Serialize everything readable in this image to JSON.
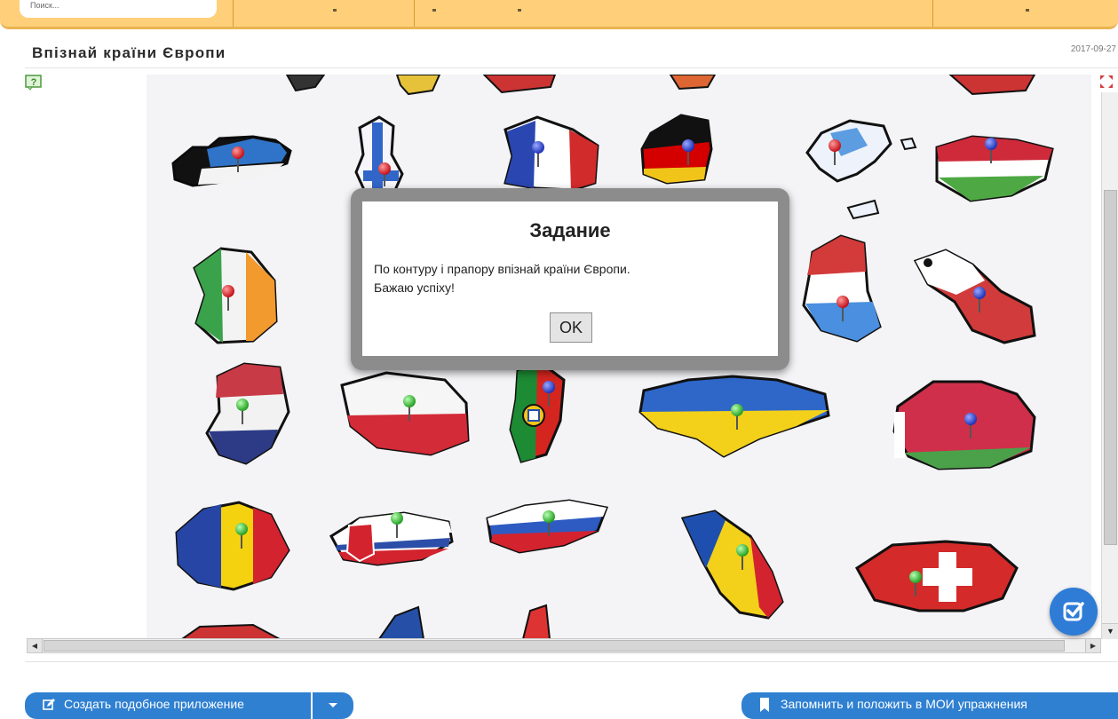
{
  "header": {
    "search_placeholder": "Поиск..."
  },
  "exercise": {
    "title": "Впізнай країни Європи",
    "date": "2017-09-27"
  },
  "modal": {
    "title": "Задание",
    "line1": "По контуру і прапору впізнай країни Європи.",
    "line2": "Бажаю успіху!",
    "ok_label": "OK"
  },
  "actions": {
    "create_label": "Создать подобное приложение",
    "remember_label": "Запомнить и положить в МОИ упражнения"
  },
  "colors": {
    "accent": "#2f80d1",
    "topbar": "#ffd079",
    "pin_red": "#e2222b",
    "pin_blue": "#2a46d6",
    "pin_green": "#39c23a"
  },
  "board": {
    "countries": [
      {
        "name": "Estonia",
        "pin": "red"
      },
      {
        "name": "Finland",
        "pin": "red"
      },
      {
        "name": "France",
        "pin": "blue"
      },
      {
        "name": "Germany",
        "pin": "blue"
      },
      {
        "name": "Greece",
        "pin": "red"
      },
      {
        "name": "Hungary",
        "pin": "blue"
      },
      {
        "name": "Ireland",
        "pin": "red"
      },
      {
        "name": "Luxembourg",
        "pin": "red"
      },
      {
        "name": "Malta",
        "pin": "blue"
      },
      {
        "name": "Netherlands",
        "pin": "green"
      },
      {
        "name": "Poland",
        "pin": "green"
      },
      {
        "name": "Portugal",
        "pin": "blue"
      },
      {
        "name": "Ukraine",
        "pin": "green"
      },
      {
        "name": "Belarus",
        "pin": "blue"
      },
      {
        "name": "Romania",
        "pin": "green"
      },
      {
        "name": "Slovakia",
        "pin": "green"
      },
      {
        "name": "Slovenia",
        "pin": "green"
      },
      {
        "name": "Moldova",
        "pin": "green"
      },
      {
        "name": "Switzerland",
        "pin": "green"
      }
    ]
  }
}
